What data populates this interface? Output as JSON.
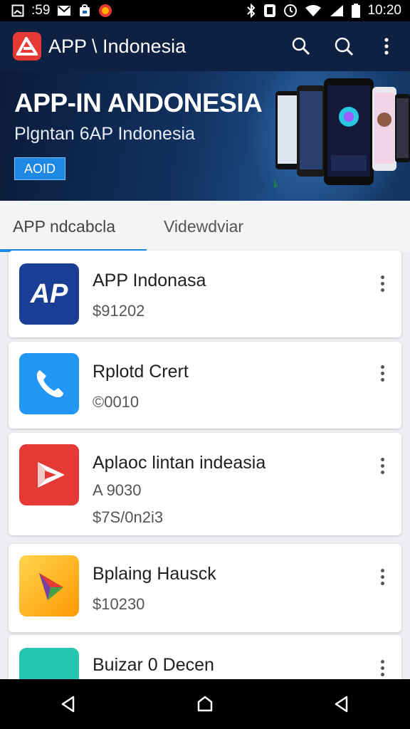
{
  "status_bar": {
    "time_left": ":59",
    "time_right": "10:20"
  },
  "app_bar": {
    "title": "APP \\ Indonesia",
    "icons": [
      "app-logo-icon",
      "search-icon",
      "search-icon",
      "more-vert-icon"
    ]
  },
  "banner": {
    "title": "APP-IN ANDONESIA",
    "subtitle": "Plgntan 6AP Indonesia",
    "button_label": "AOID"
  },
  "tabs": [
    {
      "label": "APP ndcabcla",
      "active": true
    },
    {
      "label": "Videwdviar",
      "active": false
    }
  ],
  "apps": [
    {
      "name": "APP Indonasa",
      "lines": [
        "$91202"
      ],
      "icon": "ap-logo-icon",
      "icon_text": "AP"
    },
    {
      "name": "Rplotd Crert",
      "lines": [
        "©0010"
      ],
      "icon": "phone-icon"
    },
    {
      "name": "Aplaoc lintan indeasia",
      "lines": [
        "A 9030",
        "$7S/0n2i3"
      ],
      "icon": "red-play-icon"
    },
    {
      "name": "Bplaing Hausck",
      "lines": [
        "$10230"
      ],
      "icon": "colorful-play-icon"
    },
    {
      "name": "Buizar 0 Decen",
      "lines": [],
      "icon": "teal-app-icon"
    }
  ],
  "colors": {
    "app_bar": "#0f2142",
    "accent": "#1e88e5",
    "logo_red": "#e53935"
  }
}
